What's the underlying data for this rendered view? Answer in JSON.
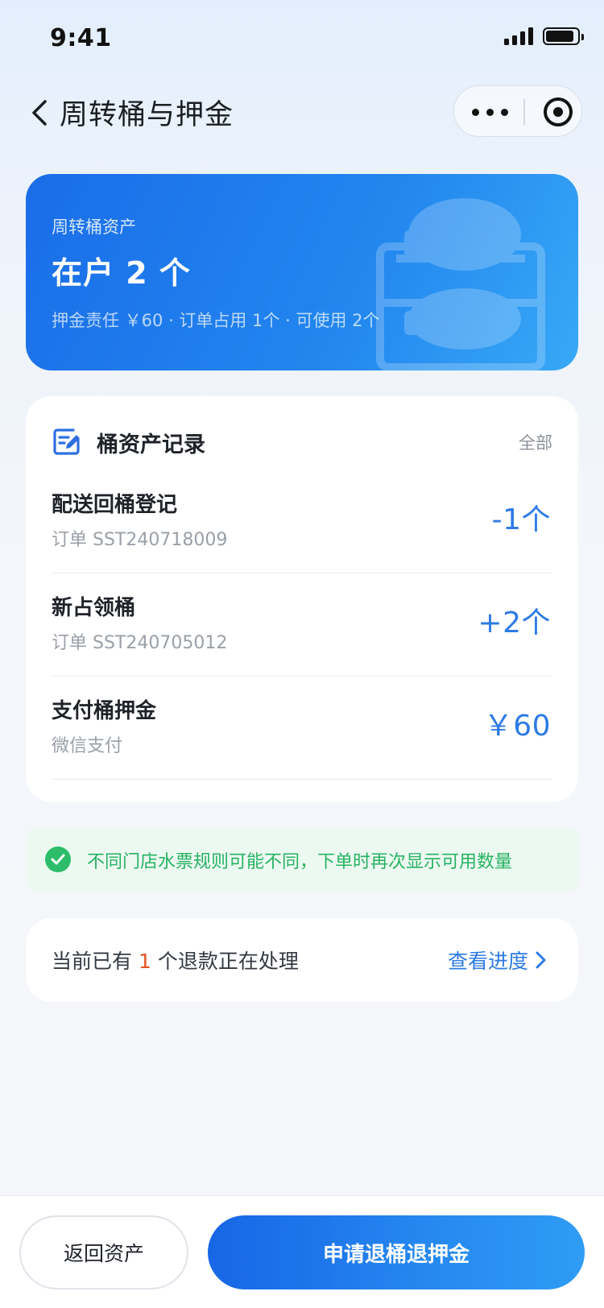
{
  "status_bar": {
    "time": "9:41"
  },
  "nav": {
    "title": "周转桶与押金"
  },
  "asset_card": {
    "label": "周转桶资产",
    "count_text": "在户 2 个",
    "meta": "押金责任 ￥60 · 订单占用 1个 · 可使用 2个"
  },
  "records": {
    "title": "桶资产记录",
    "all_label": "全部",
    "items": [
      {
        "title": "配送回桶登记",
        "sub": "订单 SST240718009",
        "value": "-1个"
      },
      {
        "title": "新占领桶",
        "sub": "订单 SST240705012",
        "value": "+2个"
      },
      {
        "title": "支付桶押金",
        "sub": "微信支付",
        "value": "￥60"
      }
    ]
  },
  "notice": {
    "text": "不同门店水票规则可能不同，下单时再次显示可用数量"
  },
  "refund": {
    "prefix": "当前已有",
    "count": "1",
    "suffix": "个退款正在处理",
    "link": "查看进度"
  },
  "bottom": {
    "secondary_label": "返回资产",
    "primary_label": "申请退桶退押金"
  },
  "colors": {
    "accent": "#2d7be5",
    "success": "#27b262",
    "warning": "#e35325"
  }
}
